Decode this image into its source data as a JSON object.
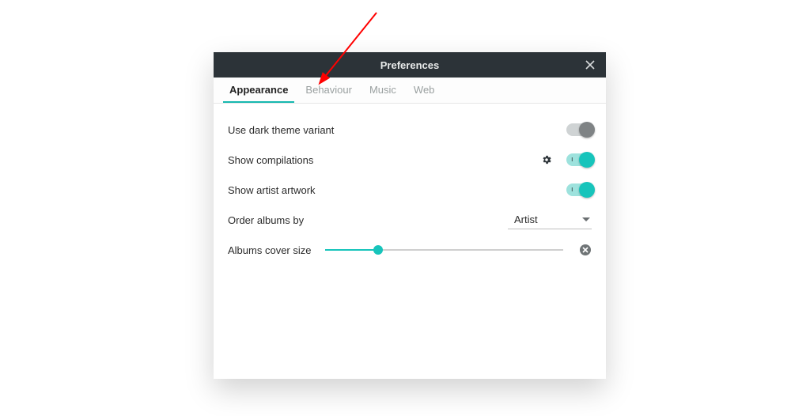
{
  "window": {
    "title": "Preferences"
  },
  "tabs": [
    "Appearance",
    "Behaviour",
    "Music",
    "Web"
  ],
  "active_tab_index": 0,
  "rows": {
    "dark_theme": {
      "label": "Use dark theme variant",
      "value": false
    },
    "compilations": {
      "label": "Show compilations",
      "value": true
    },
    "artist_art": {
      "label": "Show artist artwork",
      "value": true
    },
    "order_by": {
      "label": "Order albums by",
      "value": "Artist"
    },
    "cover_size": {
      "label": "Albums cover size",
      "value": 0.22
    }
  },
  "colors": {
    "accent": "#17c4bb"
  }
}
